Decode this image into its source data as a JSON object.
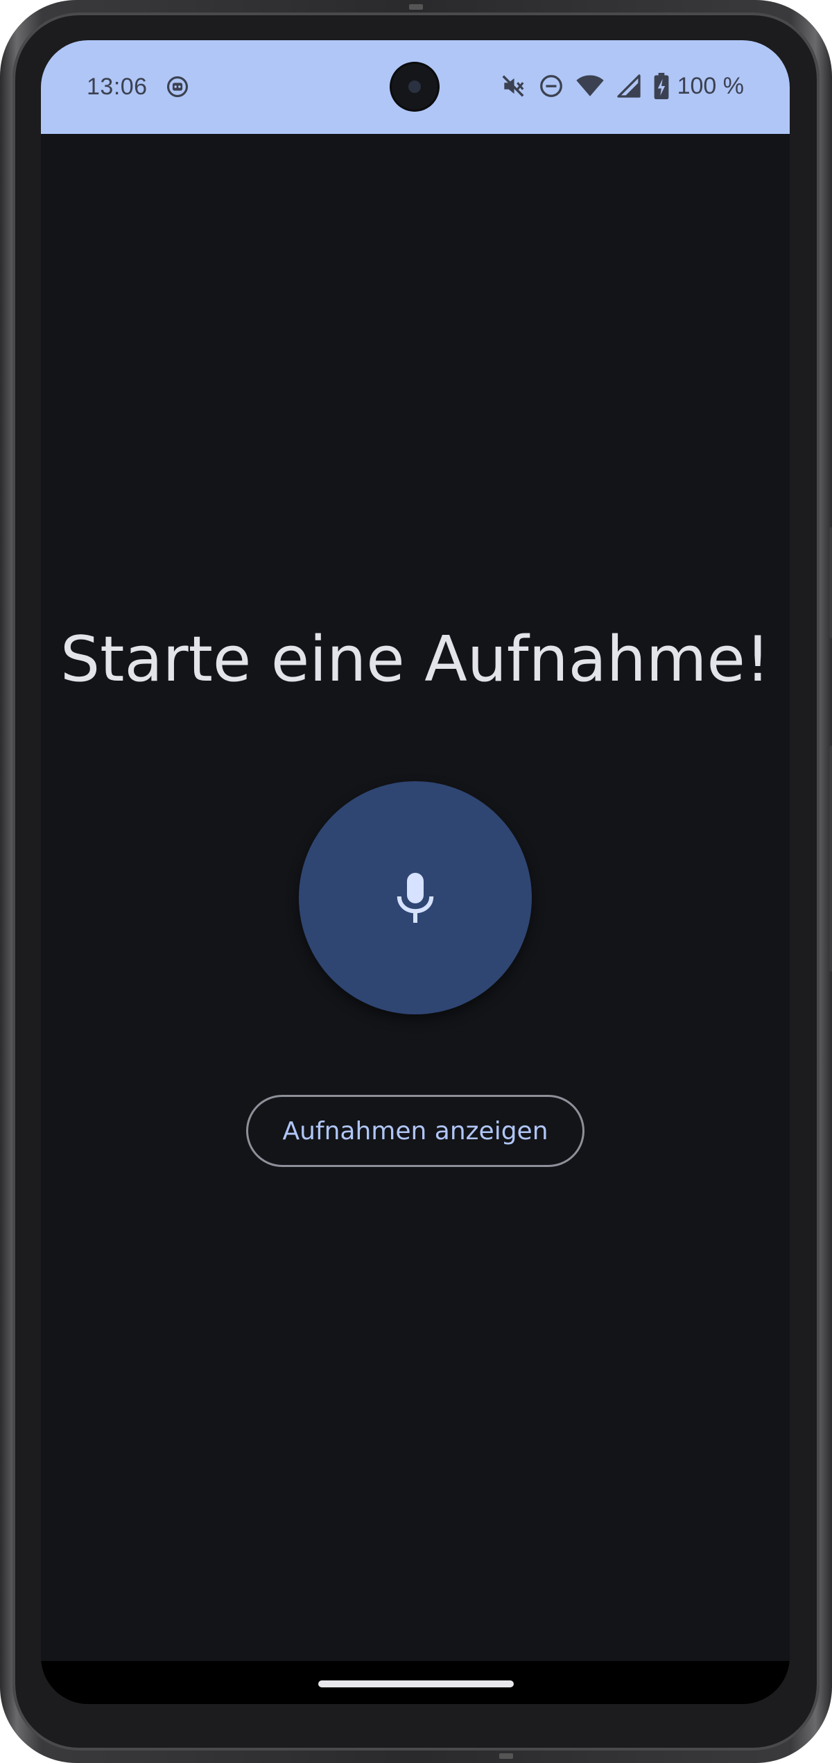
{
  "status_bar": {
    "time": "13:06",
    "battery_text": "100 %",
    "icons": [
      "notification-icon",
      "mute-icon",
      "do-not-disturb-icon",
      "wifi-icon",
      "signal-icon",
      "battery-charging-icon"
    ]
  },
  "main": {
    "headline": "Starte eine Aufnahme!",
    "record_button_icon": "microphone-icon",
    "show_recordings_label": "Aufnahmen anzeigen"
  },
  "colors": {
    "status_bar_bg": "#b0c6f7",
    "screen_bg": "#131418",
    "record_button_bg": "#2f4673",
    "accent_text": "#b0c6f7",
    "headline_text": "#e3e3ea"
  }
}
